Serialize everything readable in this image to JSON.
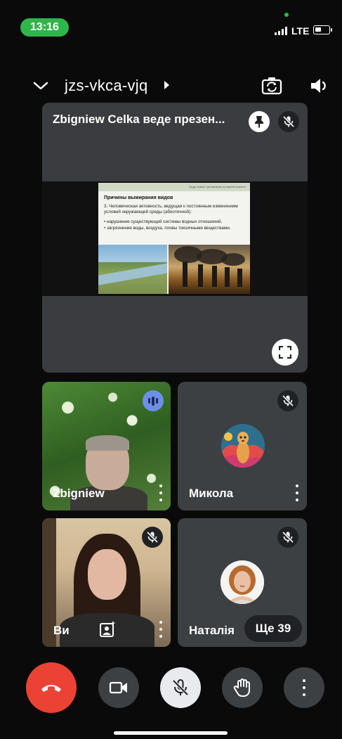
{
  "status_bar": {
    "time": "13:16",
    "network": "LTE",
    "battery_level": 0.45
  },
  "header": {
    "meeting_code": "jzs-vkca-vjq",
    "icons": [
      "chevron-down-icon",
      "caret-right-icon",
      "camera-switch-icon",
      "speaker-icon"
    ]
  },
  "presentation": {
    "title": "Zbigniew Celka веде презен...",
    "icons": [
      "pin-icon",
      "mic-off-icon",
      "fullscreen-icon"
    ],
    "slide": {
      "header_text": "Виды живых организмов на нашей планете",
      "heading": "Причины вымирания видов",
      "body": "3. Человеческая активность, ведущая к постоянным изменениям условий окружающей среды (абиотичной):",
      "bullets": [
        "нарушение существующей системы водных отношений,",
        "загрязнение воды, воздуха, почвы токсичными веществами."
      ]
    }
  },
  "participants": [
    {
      "name": "Zbigniew",
      "speaking": true,
      "icons": [
        "speaking-icon",
        "more-vert-icon"
      ]
    },
    {
      "name": "Микола",
      "muted": true,
      "icons": [
        "mic-off-icon",
        "more-vert-icon"
      ]
    },
    {
      "name": "Ви",
      "muted": true,
      "icons": [
        "mic-off-icon",
        "visual-effects-icon",
        "more-vert-icon"
      ]
    },
    {
      "name": "Наталія",
      "muted": true,
      "icons": [
        "mic-off-icon"
      ]
    }
  ],
  "overflow": {
    "more_label": "Ще 39"
  },
  "controls": {
    "icons": [
      "end-call-icon",
      "camera-icon",
      "mic-off-icon",
      "raise-hand-icon",
      "more-vert-icon"
    ],
    "colors": {
      "end_call": "#ea4335",
      "tile": "#3c4043",
      "speaking": "#6e8fe8"
    }
  }
}
